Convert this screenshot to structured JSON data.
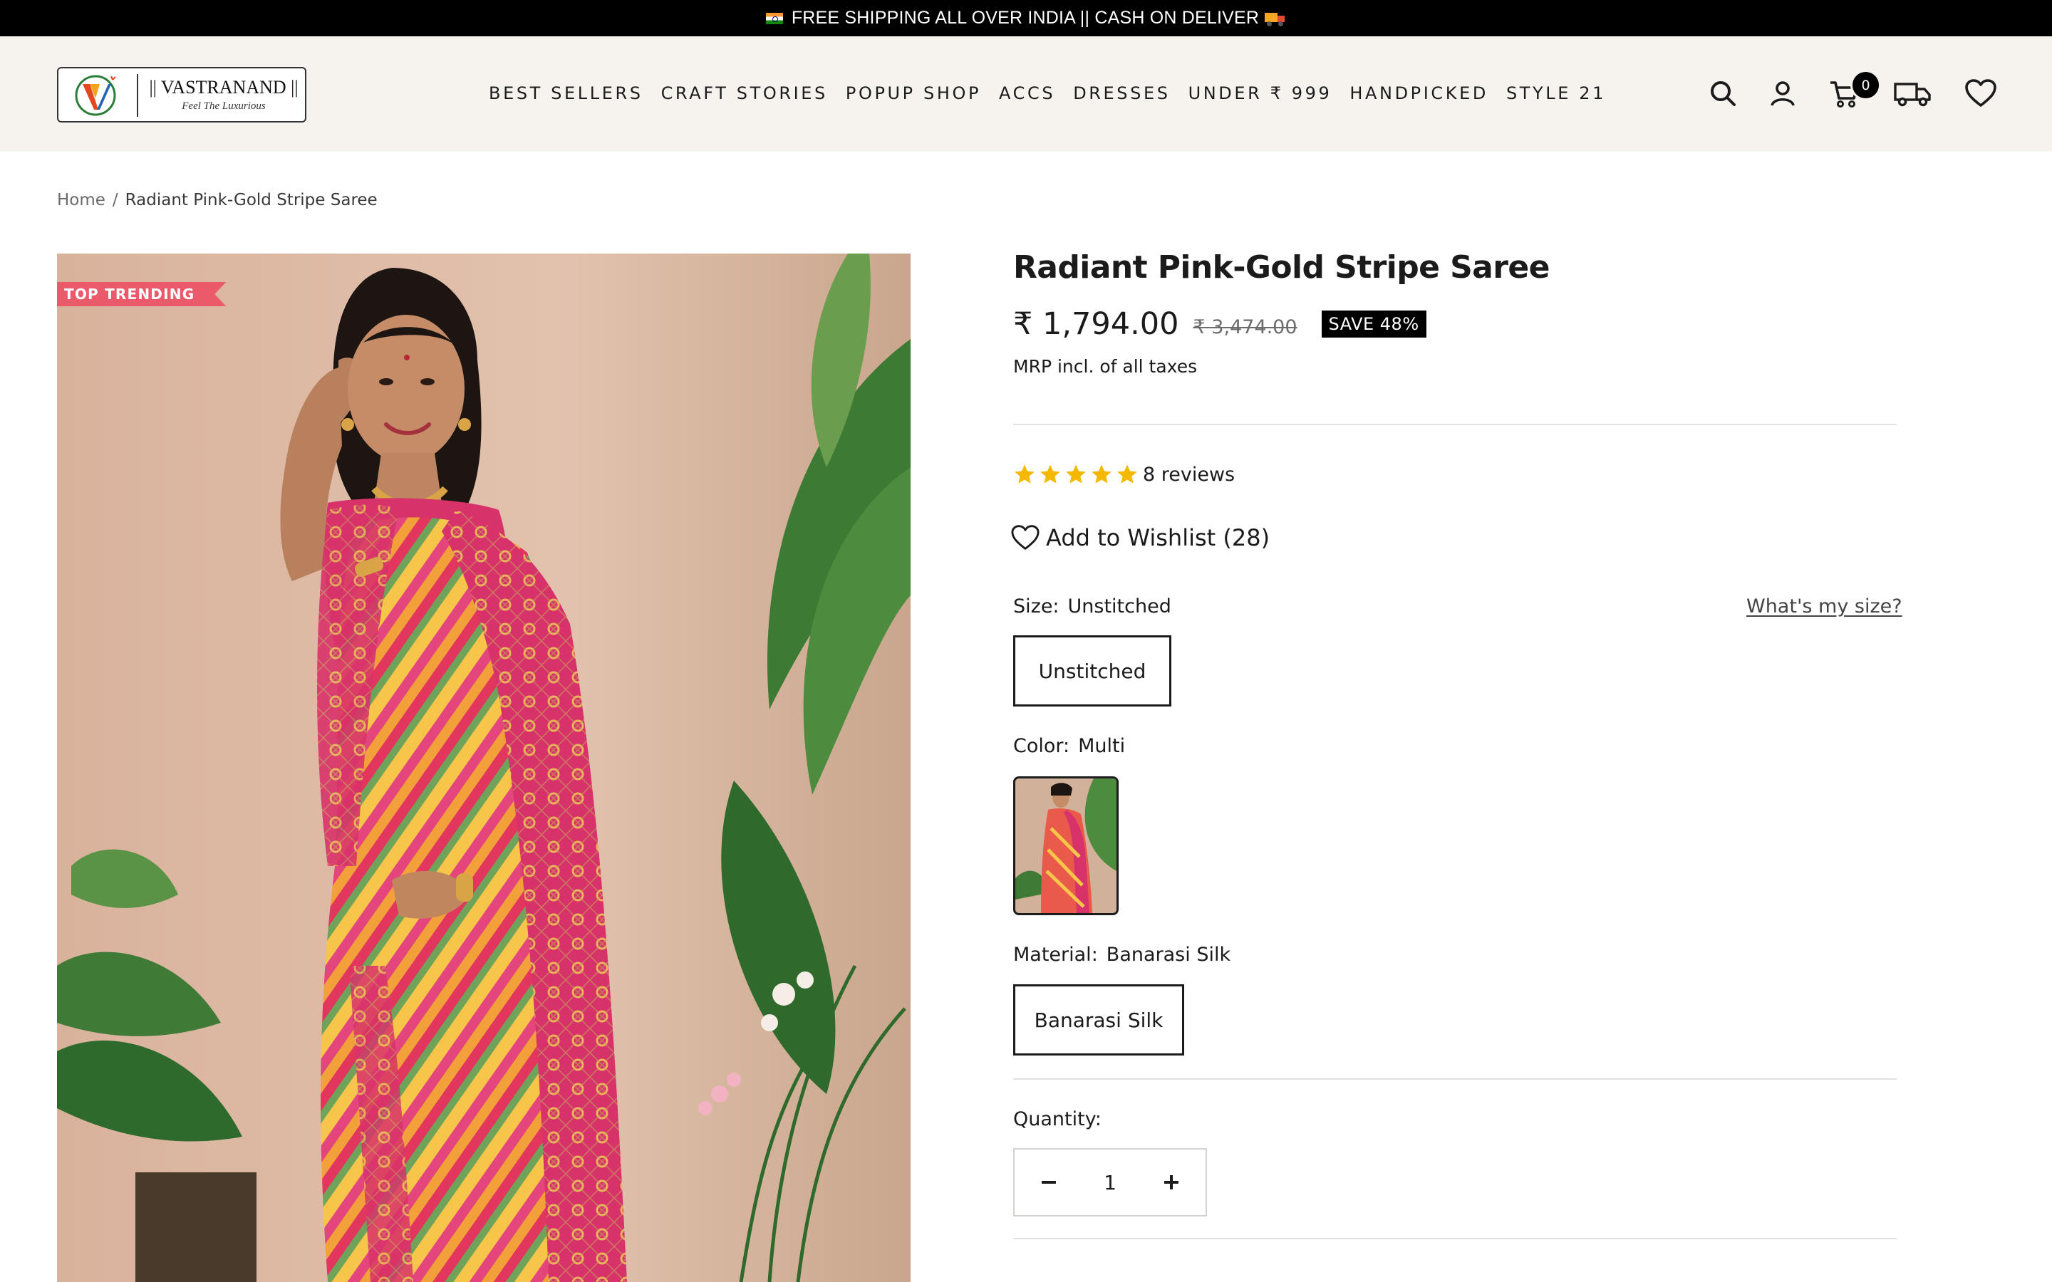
{
  "announcement": {
    "text": "FREE SHIPPING ALL OVER INDIA || CASH ON DELIVER"
  },
  "logo": {
    "brand": "|| VASTRANAND ||",
    "tagline": "Feel The Luxurious"
  },
  "nav": {
    "items": [
      {
        "label": "BEST SELLERS"
      },
      {
        "label": "CRAFT STORIES"
      },
      {
        "label": "POPUP SHOP"
      },
      {
        "label": "ACCS"
      },
      {
        "label": "DRESSES"
      },
      {
        "label": "UNDER ₹ 999"
      },
      {
        "label": "HANDPICKED"
      },
      {
        "label": "STYLE 21"
      }
    ]
  },
  "header_icons": {
    "search": "search-icon",
    "account": "account-icon",
    "cart": "cart-icon",
    "track": "truck-icon",
    "wishlist": "heart-icon",
    "cart_count": "0"
  },
  "breadcrumb": {
    "home": "Home",
    "separator": "/",
    "current": "Radiant Pink-Gold Stripe Saree"
  },
  "product": {
    "badge": "TOP TRENDING",
    "title": "Radiant Pink-Gold Stripe Saree",
    "price": "₹ 1,794.00",
    "compare_price": "₹ 3,474.00",
    "save_label": "SAVE 48%",
    "tax_note": "MRP incl. of all taxes",
    "rating": 5,
    "reviews_label": "8 reviews",
    "wishlist_label": "Add to Wishlist (28)",
    "size": {
      "label": "Size:",
      "value": "Unstitched",
      "options": [
        "Unstitched"
      ],
      "guide": "What's my size?"
    },
    "color": {
      "label": "Color:",
      "value": "Multi"
    },
    "material": {
      "label": "Material:",
      "value": "Banarasi Silk",
      "options": [
        "Banarasi Silk"
      ]
    },
    "quantity": {
      "label": "Quantity:",
      "value": "1"
    }
  },
  "colors": {
    "announce_bg": "#000000",
    "header_bg": "#f6f3ef",
    "badge": "#ea5a6a",
    "star": "#f5b800",
    "text": "#1c1b1b"
  }
}
